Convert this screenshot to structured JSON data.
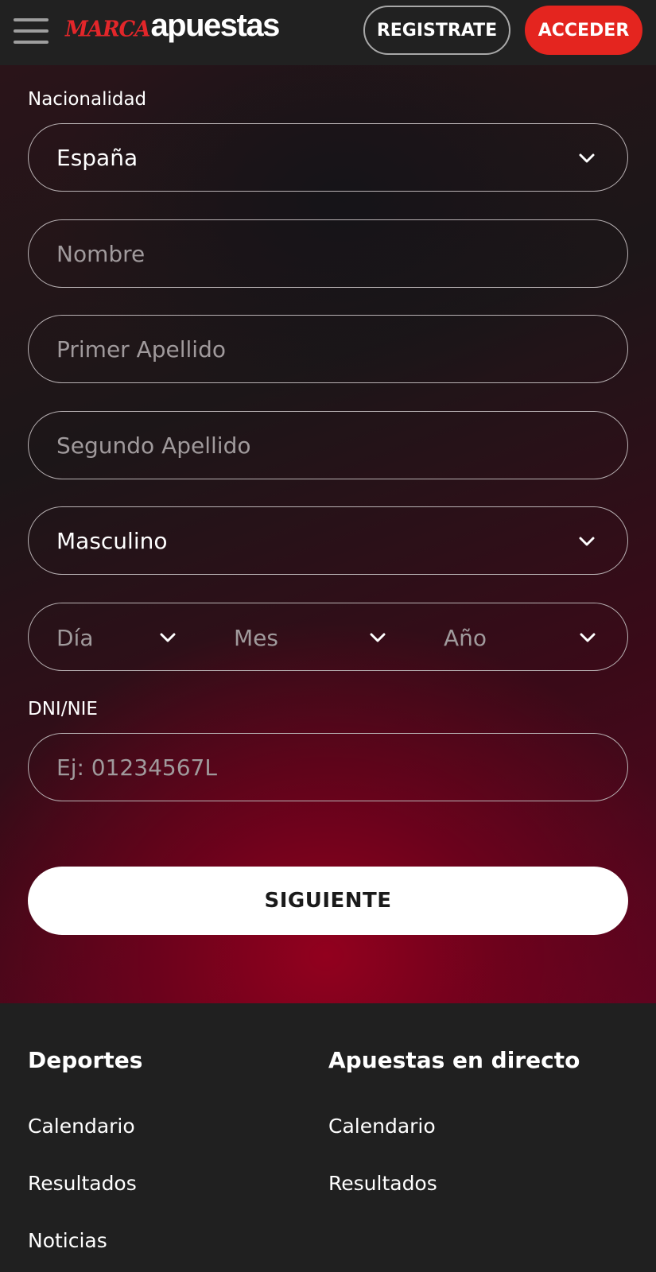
{
  "header": {
    "logo_brand": "MARCA",
    "logo_suffix": "apuestas",
    "register_label": "REGISTRATE",
    "login_label": "ACCEDER"
  },
  "form": {
    "nationality_label": "Nacionalidad",
    "nationality_value": "España",
    "first_name_placeholder": "Nombre",
    "last_name1_placeholder": "Primer Apellido",
    "last_name2_placeholder": "Segundo Apellido",
    "gender_value": "Masculino",
    "birth_day_placeholder": "Día",
    "birth_month_placeholder": "Mes",
    "birth_year_placeholder": "Año",
    "dni_label": "DNI/NIE",
    "dni_placeholder": "Ej: 01234567L",
    "next_label": "SIGUIENTE"
  },
  "footer": {
    "col1": {
      "heading": "Deportes",
      "links": [
        "Calendario",
        "Resultados",
        "Noticias"
      ]
    },
    "col2": {
      "heading": "Apuestas en directo",
      "links": [
        "Calendario",
        "Resultados"
      ]
    }
  },
  "colors": {
    "brand_red": "#e4251f",
    "header_bg": "#212121",
    "footer_bg": "#202020"
  },
  "icons": {
    "menu": "hamburger-menu-icon",
    "dropdown": "chevron-down-icon"
  }
}
